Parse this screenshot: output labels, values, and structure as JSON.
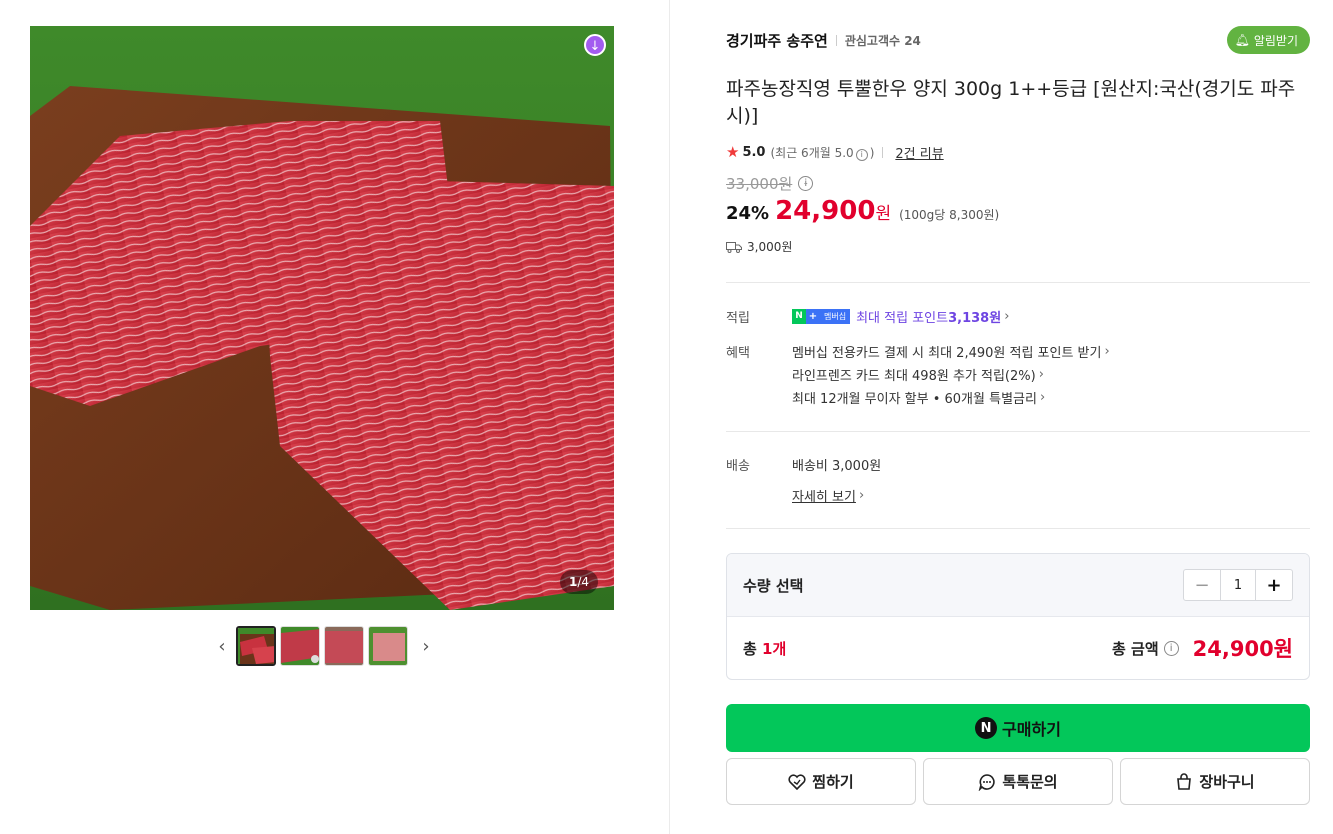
{
  "gallery": {
    "counter_current": "1",
    "counter_total": "/4",
    "download_icon": "download-icon",
    "thumb_count": 4,
    "active_index": 0
  },
  "store": {
    "name": "경기파주 송주연",
    "fans": "관심고객수 24",
    "alarm_label": "알림받기"
  },
  "product": {
    "title": "파주농장직영 투뿔한우 양지 300g 1++등급 [원산지:국산(경기도 파주시)]",
    "rating": "5.0",
    "recent_rating": "(최근 6개월 5.0",
    "recent_close": ")",
    "reviews": "2건 리뷰",
    "original_price": "33,000원",
    "discount": "24%",
    "sale_price": "24,900",
    "won": "원",
    "unit_price": "(100g당 8,300원)",
    "shipping_fee": "3,000원"
  },
  "benefits": {
    "points_label": "적립",
    "badge_n": "N",
    "badge_plus": "+",
    "badge_text": "멤버십",
    "points_text": "최대 적립 포인트 ",
    "points_value": "3,138원",
    "benefit_label": "혜택",
    "lines": [
      "멤버십 전용카드 결제 시 최대 2,490원 적립 포인트 받기",
      "라인프렌즈 카드 최대 498원 추가 적립(2%)",
      "최대 12개월 무이자 할부 • 60개월 특별금리"
    ]
  },
  "delivery": {
    "label": "배송",
    "fee": "배송비 3,000원",
    "detail_link": "자세히 보기"
  },
  "quantity": {
    "label": "수량 선택",
    "minus": "−",
    "value": "1",
    "plus": "+",
    "total_prefix": "총 ",
    "total_count": "1개",
    "total_label": "총 금액",
    "total_amount": "24,900원"
  },
  "actions": {
    "buy": "구매하기",
    "npay": "N",
    "wish": "찜하기",
    "talk": "톡톡문의",
    "cart": "장바구니"
  },
  "colors": {
    "accent_green": "#03c75a",
    "price_red": "#e1002d",
    "alarm_green": "#62b341",
    "point_purple": "#6e45e2"
  }
}
